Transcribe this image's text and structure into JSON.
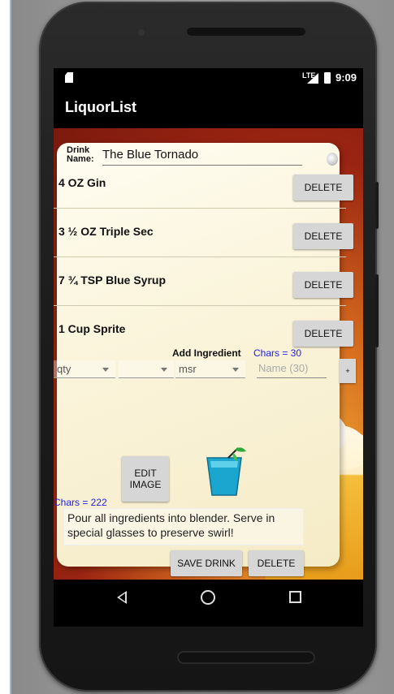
{
  "status_bar": {
    "network": "LTE",
    "time": "9:09"
  },
  "app_bar": {
    "title": "LiquorList"
  },
  "drink": {
    "name_label_line1": "Drink",
    "name_label_line2": "Name:",
    "name": "The Blue Tornado"
  },
  "ingredients": [
    {
      "text": "4 OZ Gin",
      "delete_label": "DELETE"
    },
    {
      "text": "3 ½ OZ Triple Sec",
      "delete_label": "DELETE"
    },
    {
      "text": "7 ¾ TSP Blue Syrup",
      "delete_label": "DELETE"
    },
    {
      "text": "1 Cup Sprite",
      "delete_label": "DELETE"
    }
  ],
  "add_ingredient": {
    "label": "Add Ingredient",
    "chars": "Chars = 30",
    "qty_value": "qty",
    "fraction_value": "",
    "measure_value": "msr",
    "name_placeholder": "Name (30)",
    "add_button": "+"
  },
  "image_section": {
    "edit_image_line1": "EDIT",
    "edit_image_line2": "IMAGE",
    "image_icon": "blue-cocktail-glass-icon"
  },
  "instructions": {
    "chars": "Chars = 222",
    "text": "Pour all ingredients into blender. Serve in special glasses to preserve swirl!"
  },
  "actions": {
    "save_label": "SAVE DRINK",
    "delete_label": "DELETE"
  },
  "nav": {
    "back_icon": "back-icon",
    "home_icon": "home-icon",
    "recents_icon": "recents-icon"
  },
  "colors": {
    "accent_blue": "#1f1fe6",
    "button_gray": "#d6d6d6"
  }
}
